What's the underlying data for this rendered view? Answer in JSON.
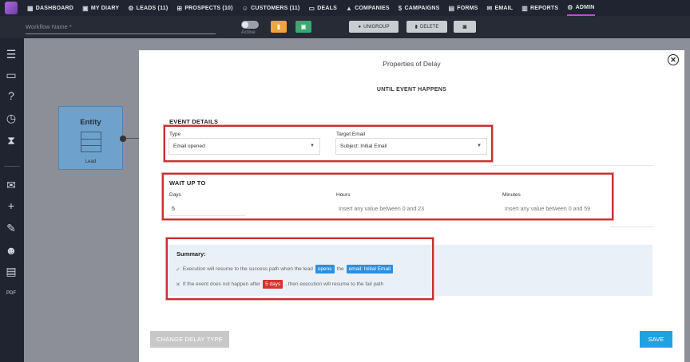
{
  "nav": {
    "items": [
      {
        "label": "DASHBOARD",
        "icon": "grid-icon",
        "glyph": "▦"
      },
      {
        "label": "MY DIARY",
        "icon": "calendar-icon",
        "glyph": "▣"
      },
      {
        "label": "LEADS (11)",
        "icon": "leads-icon",
        "glyph": "⚙"
      },
      {
        "label": "PROSPECTS (10)",
        "icon": "prospects-icon",
        "glyph": "⊞"
      },
      {
        "label": "CUSTOMERS (11)",
        "icon": "customers-icon",
        "glyph": "☺"
      },
      {
        "label": "DEALS",
        "icon": "deals-icon",
        "glyph": "▭"
      },
      {
        "label": "COMPANIES",
        "icon": "companies-icon",
        "glyph": "▲"
      },
      {
        "label": "CAMPAIGNS",
        "icon": "campaigns-icon",
        "glyph": "$"
      },
      {
        "label": "FORMS",
        "icon": "forms-icon",
        "glyph": "▤"
      },
      {
        "label": "EMAIL",
        "icon": "email-icon",
        "glyph": "✉"
      },
      {
        "label": "REPORTS",
        "icon": "reports-icon",
        "glyph": "▥"
      },
      {
        "label": "ADMIN",
        "icon": "admin-gear-icon",
        "glyph": "⚙",
        "active": true
      }
    ]
  },
  "workflow": {
    "name_placeholder": "Workflow Name *",
    "active_label": "Active",
    "unigroup_label": "UNIGROUP",
    "delete_label": "DELETE"
  },
  "entity": {
    "title": "Entity",
    "subtitle": "Lead"
  },
  "modal": {
    "title": "Properties of Delay",
    "mode": "UNTIL EVENT HAPPENS",
    "event_details": {
      "heading": "EVENT DETAILS",
      "type_label": "Type",
      "type_value": "Email opened",
      "target_label": "Target Email",
      "target_value": "Subject: Initial Email"
    },
    "wait": {
      "heading": "WAIT UP TO",
      "days_label": "Days",
      "days_value": "5",
      "hours_label": "Hours",
      "hours_placeholder": "Insert any value between 0 and 23",
      "minutes_label": "Minutes",
      "minutes_placeholder": "Insert any value between 0 and 59"
    },
    "summary": {
      "heading": "Summary:",
      "line1_pre": "Execution will resume to the success path when the lead",
      "line1_tag1": "opens",
      "line1_mid": "the",
      "line1_tag2": "email: Initial Email",
      "line2_pre": "If the event does not happen after",
      "line2_tag": "5 days",
      "line2_post": ", then execution will resume to the fail path"
    },
    "change_button": "CHANGE DELAY TYPE",
    "save_button": "SAVE"
  },
  "colors": {
    "accent_admin": "#c048d8",
    "highlight_frame": "#c73030",
    "save_blue": "#1fa3e0",
    "tag_blue": "#2d8fe0",
    "tag_red": "#d8322a"
  }
}
